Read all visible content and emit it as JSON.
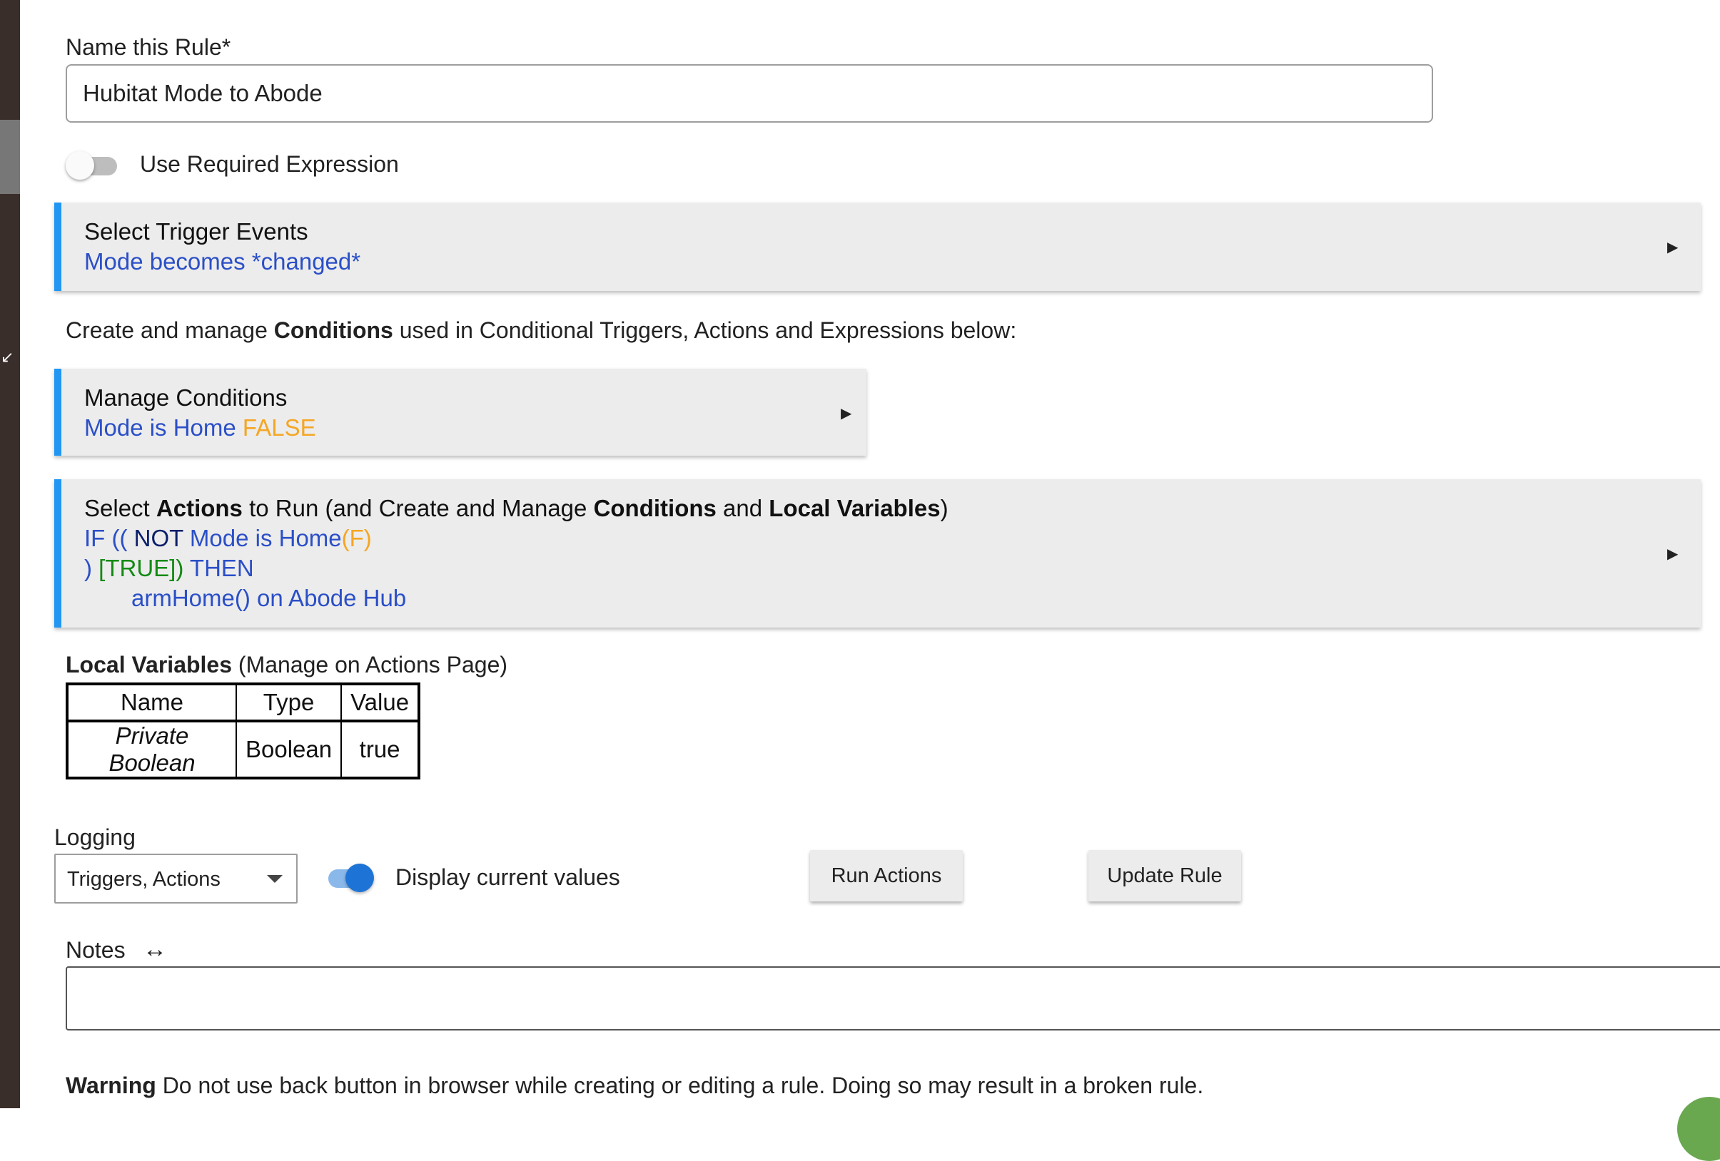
{
  "rule_name": {
    "label": "Name this Rule*",
    "value": "Hubitat Mode to Abode"
  },
  "required_expression": {
    "label": "Use Required Expression",
    "enabled": false
  },
  "trigger_panel": {
    "title": "Select Trigger Events",
    "summary": "Mode becomes *changed*"
  },
  "conditions_intro": {
    "prefix": "Create and manage ",
    "bold": "Conditions",
    "suffix": " used in Conditional Triggers, Actions and Expressions below:"
  },
  "conditions_panel": {
    "title": "Manage Conditions",
    "condition": "Mode is Home",
    "state": "FALSE"
  },
  "actions_panel": {
    "title_parts": {
      "t1": "Select ",
      "b1": "Actions",
      "t2": " to Run (and Create and Manage ",
      "b2": "Conditions",
      "t3": " and ",
      "b3": "Local Variables",
      "t4": ")"
    },
    "line1": {
      "if": "IF ((",
      "not": "NOT",
      "cond": "Mode is Home",
      "state": "(F)"
    },
    "line2": {
      "close": ")",
      "result": "[TRUE])",
      "then": "THEN"
    },
    "line3": "armHome() on Abode Hub"
  },
  "local_variables": {
    "title_bold": "Local Variables",
    "title_rest": " (Manage on Actions Page)",
    "columns": [
      "Name",
      "Type",
      "Value"
    ],
    "rows": [
      {
        "name": "Private Boolean",
        "type": "Boolean",
        "value": "true"
      }
    ]
  },
  "logging": {
    "label": "Logging",
    "selected": "Triggers, Actions"
  },
  "display_values": {
    "label": "Display current values",
    "enabled": true
  },
  "buttons": {
    "run_actions": "Run Actions",
    "update_rule": "Update Rule"
  },
  "notes": {
    "label": "Notes",
    "resize_icon": "↔",
    "value": ""
  },
  "warning": {
    "bold": "Warning",
    "text": " Do not use back button in browser while creating or editing a rule. Doing so may result in a broken rule."
  },
  "icons": {
    "collapse": "collapse-arrow-icon",
    "expand": "triangle-right-icon",
    "notes_resize": "horizontal-arrows-icon"
  },
  "colors": {
    "accent": "#2196f3",
    "condition_blue": "#2b4fc7",
    "false_orange": "#f5a623",
    "true_green": "#148a14",
    "not_navy": "#0b1f6b",
    "sidebar": "#3a2e2b"
  }
}
